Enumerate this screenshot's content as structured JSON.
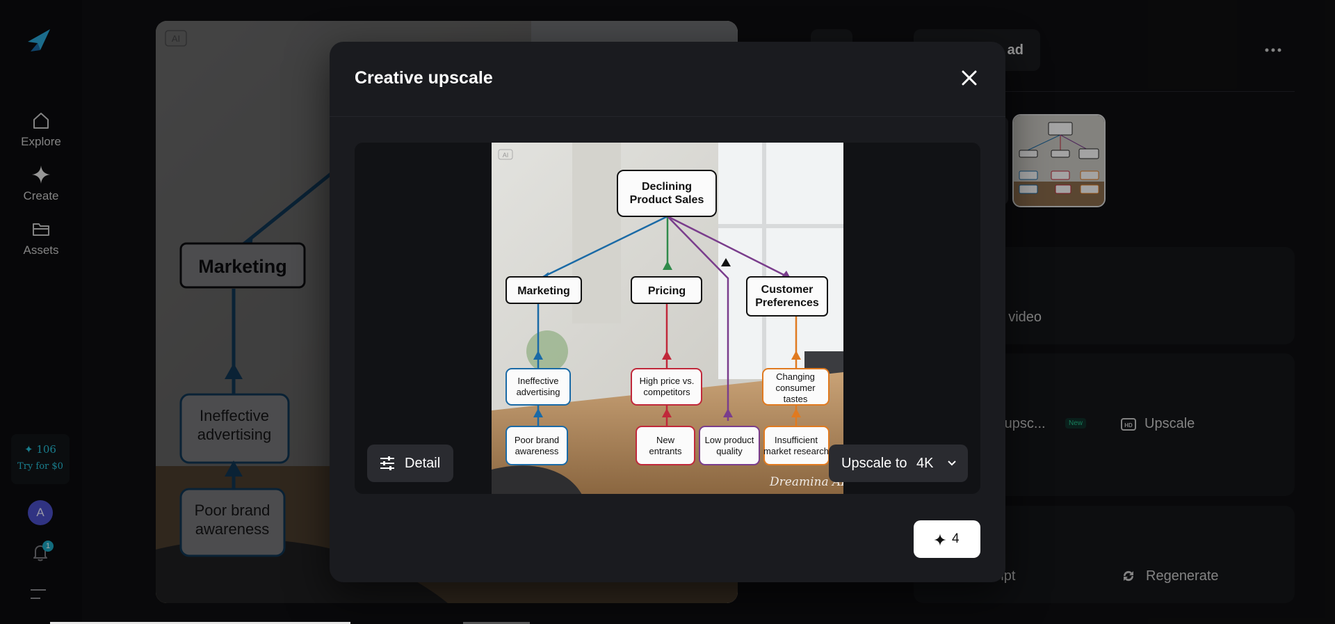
{
  "nav": {
    "items": [
      {
        "label": "Explore",
        "icon": "home-icon"
      },
      {
        "label": "Create",
        "icon": "sparkle-icon"
      },
      {
        "label": "Assets",
        "icon": "folder-icon"
      }
    ],
    "credits": {
      "count": "106",
      "try_label": "Try for $0"
    },
    "avatar_letter": "A",
    "notification_count": "1"
  },
  "background_diagram": {
    "badge": "AI",
    "nodes": [
      "Marketing",
      "Ineffective advertising",
      "Poor brand awareness"
    ]
  },
  "right_panel": {
    "download_label": "ad",
    "create_video_label": "te video",
    "creative_upscale_label": "e upsc...",
    "new_badge": "New",
    "upscale_label": "Upscale",
    "second_line_label": "e",
    "prompt_label": "ompt",
    "regenerate_label": "Regenerate"
  },
  "modal": {
    "title": "Creative upscale",
    "detail_label": "Detail",
    "upscale_to_label": "Upscale to",
    "resolution": "4K",
    "cost": "4"
  },
  "preview_image": {
    "badge": "AI",
    "watermark": "Dreamina AI",
    "root": "Declining Product Sales",
    "categories": [
      {
        "label": "Marketing",
        "color": "#1a6aa6"
      },
      {
        "label": "Pricing",
        "color": "#c0283a"
      },
      {
        "label": "Customer Preferences",
        "color": "#e07a20"
      }
    ],
    "causes": [
      {
        "label": "Ineffective advertising",
        "color": "#1a6aa6"
      },
      {
        "label": "Poor brand awareness",
        "color": "#1a6aa6"
      },
      {
        "label": "High price vs. competitors",
        "color": "#c0283a"
      },
      {
        "label": "New entrants",
        "color": "#c0283a"
      },
      {
        "label": "Low product quality",
        "color": "#7a3d8c"
      },
      {
        "label": "Changing consumer tastes",
        "color": "#e07a20"
      },
      {
        "label": "Insufficient market research",
        "color": "#e07a20"
      }
    ]
  }
}
